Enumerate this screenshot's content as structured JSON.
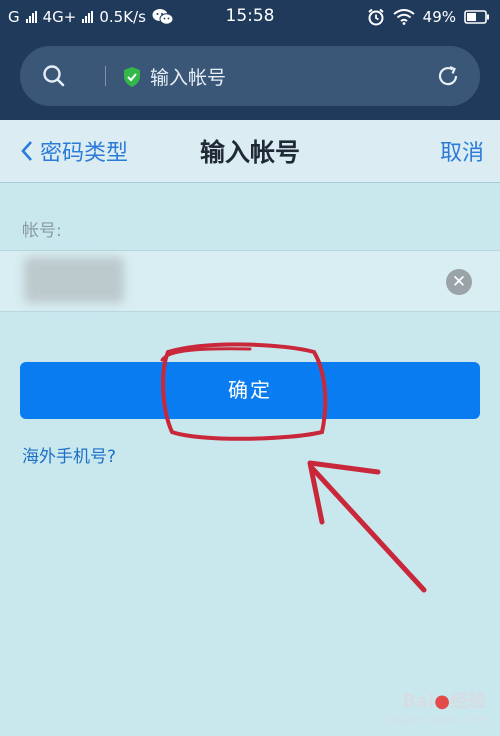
{
  "status_bar": {
    "network_left": "G",
    "network_type": "4G+",
    "speed": "0.5K/s",
    "time": "15:58",
    "battery": "49%"
  },
  "browser": {
    "url_text": "输入帐号"
  },
  "nav": {
    "back_label": "密码类型",
    "title": "输入帐号",
    "cancel_label": "取消"
  },
  "form": {
    "account_label": "帐号:",
    "clear_icon": "✕",
    "confirm_label": "确定",
    "overseas_link": "海外手机号?"
  },
  "watermark": {
    "brand_left": "Bai",
    "brand_right": "经验",
    "site": "jingyan.baidu.com"
  },
  "colors": {
    "status_bg": "#203a5c",
    "page_bg": "#c9e8ee",
    "accent": "#0a7cf2",
    "link": "#2b7bd8",
    "annotation": "#c8283a"
  },
  "icons": [
    "signal-icon",
    "wechat-icon",
    "alarm-icon",
    "wifi-icon",
    "battery-icon",
    "search-icon",
    "shield-icon",
    "reload-icon",
    "back-chevron-icon",
    "clear-icon"
  ]
}
